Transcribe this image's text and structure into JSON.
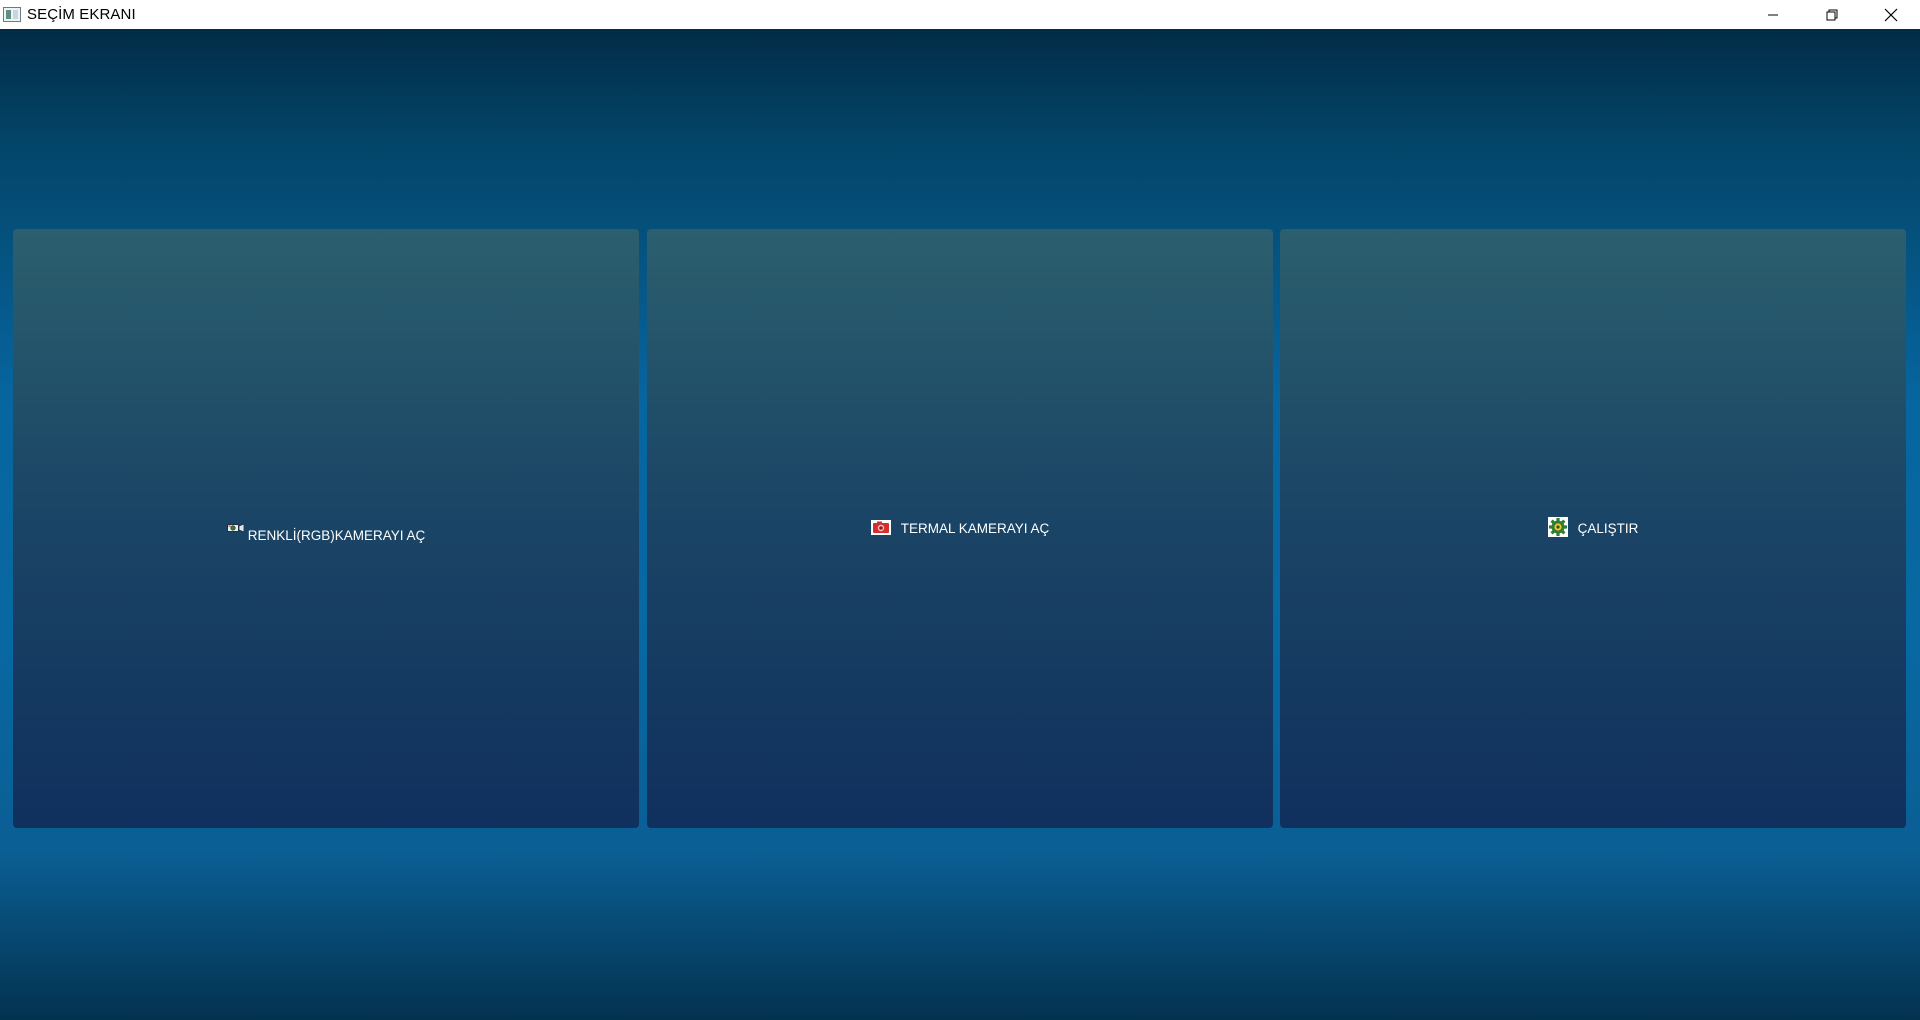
{
  "window": {
    "title": "SEÇİM EKRANI",
    "app_icon": "app-window-icon"
  },
  "controls": {
    "minimize_icon": "minimize-icon",
    "restore_icon": "restore-icon",
    "close_icon": "close-icon"
  },
  "buttons": [
    {
      "label": "RENKLİ(RGB)KAMERAYI AÇ",
      "icon": "rgb-camera-icon"
    },
    {
      "label": "TERMAL KAMERAYI AÇ",
      "icon": "thermal-camera-icon"
    },
    {
      "label": "ÇALIŞTIR",
      "icon": "gear-icon"
    }
  ],
  "colors": {
    "background_top": "#022c47",
    "background_mid": "#0766a0",
    "panel_top": "#2b5f6e",
    "panel_bottom": "#10305d",
    "label": "#ffffff"
  }
}
